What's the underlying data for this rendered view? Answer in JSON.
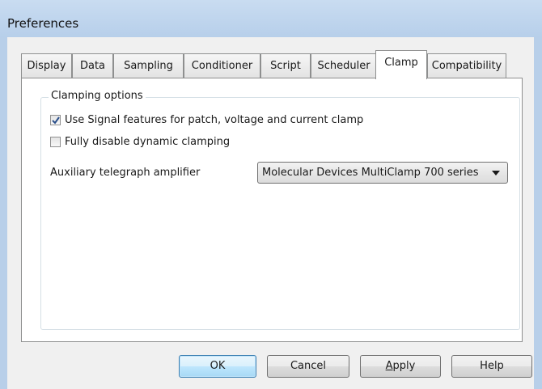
{
  "window": {
    "title": "Preferences"
  },
  "tabs": [
    {
      "label": "Display"
    },
    {
      "label": "Data"
    },
    {
      "label": "Sampling"
    },
    {
      "label": "Conditioner"
    },
    {
      "label": "Script"
    },
    {
      "label": "Scheduler"
    },
    {
      "label": "Clamp",
      "selected": true
    },
    {
      "label": "Compatibility"
    }
  ],
  "clamping": {
    "group_label": "Clamping options",
    "use_signal_features": {
      "label": "Use Signal features for patch, voltage and current clamp",
      "checked": true
    },
    "disable_dynamic_clamping": {
      "label": "Fully disable dynamic clamping",
      "checked": false
    },
    "amplifier": {
      "label": "Auxiliary telegraph amplifier",
      "selected": "Molecular Devices MultiClamp 700 series"
    }
  },
  "buttons": {
    "ok": "OK",
    "cancel": "Cancel",
    "apply_prefix": "",
    "apply_mnemonic": "A",
    "apply_rest": "pply",
    "help": "Help"
  },
  "colors": {
    "titlebar": "#b7cfea",
    "panel": "#ffffff",
    "dialog_bg": "#f0f0f0",
    "default_button": "#3c7fb1"
  }
}
